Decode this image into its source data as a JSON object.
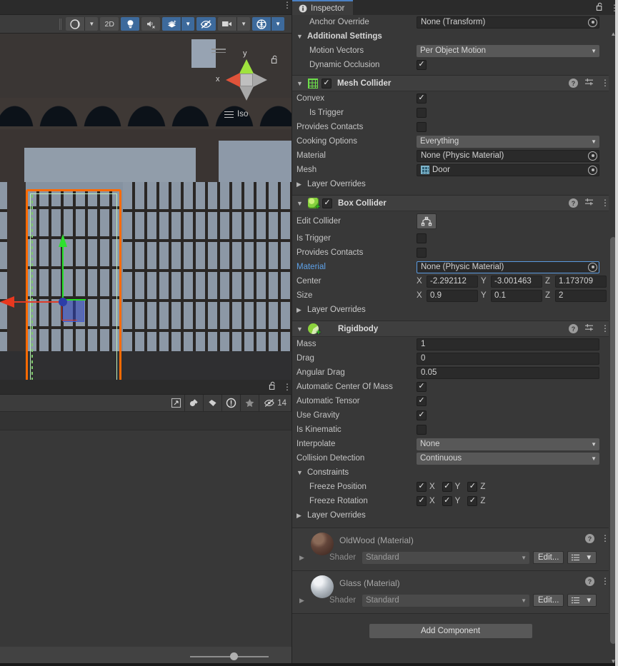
{
  "scene_panel": {
    "toolbar": {
      "shading_mode": "shaded-sphere-icon",
      "mode_2d": "2D",
      "lighting": "lightbulb-icon",
      "audio": "audio-mute-icon",
      "effects": "fx-layers-icon",
      "hidden_objects": "eye-off-icon",
      "camera": "camera-icon",
      "gizmos": "gizmos-globe-icon",
      "kebab": "⋮"
    },
    "orientation_gizmo": {
      "y_label": "y",
      "x_label": "x",
      "projection": "Iso",
      "lock": "unlocked-padlock-icon"
    }
  },
  "lower_panel": {
    "lock": "unlocked-padlock-icon",
    "kebab": "⋮",
    "buttons": [
      "expand-icon",
      "paint-icon",
      "tag-icon",
      "warning-icon",
      "star-icon"
    ],
    "hidden_count": "14",
    "zoom_slider_value": 52
  },
  "inspector": {
    "tab_label": "Inspector",
    "tab_icon": "info-icon",
    "lock_icon": "unlocked-padlock-icon",
    "kebab": "⋮",
    "top_fields": {
      "anchor_override_label": "Anchor Override",
      "anchor_override_value": "None (Transform)",
      "additional_settings_label": "Additional Settings",
      "motion_vectors_label": "Motion Vectors",
      "motion_vectors_value": "Per Object Motion",
      "dynamic_occlusion_label": "Dynamic Occlusion",
      "dynamic_occlusion_checked": true
    },
    "components": [
      {
        "id": "mesh-collider",
        "title": "Mesh Collider",
        "icon": "mesh-collider-icon",
        "enabled": true,
        "expanded": true,
        "rows": [
          {
            "label": "Convex",
            "type": "checkbox",
            "value": true,
            "indent": 0
          },
          {
            "label": "Is Trigger",
            "type": "checkbox",
            "value": false,
            "indent": 1
          },
          {
            "label": "Provides Contacts",
            "type": "checkbox",
            "value": false,
            "indent": 0
          },
          {
            "label": "Cooking Options",
            "type": "dropdown",
            "value": "Everything",
            "indent": 0
          },
          {
            "label": "Material",
            "type": "object",
            "value": "None (Physic Material)",
            "indent": 0
          },
          {
            "label": "Mesh",
            "type": "object-mesh",
            "value": "Door",
            "indent": 0
          }
        ],
        "layer_overrides_label": "Layer Overrides"
      },
      {
        "id": "box-collider",
        "title": "Box Collider",
        "icon": "box-collider-icon",
        "enabled": true,
        "expanded": true,
        "edit_collider_label": "Edit Collider",
        "edit_collider_icon": "collider-edit-icon",
        "rows": [
          {
            "label": "Is Trigger",
            "type": "checkbox",
            "value": false,
            "indent": 0
          },
          {
            "label": "Provides Contacts",
            "type": "checkbox",
            "value": false,
            "indent": 0
          },
          {
            "label": "Material",
            "type": "object",
            "value": "None (Physic Material)",
            "indent": 0,
            "highlighted": true
          }
        ],
        "center": {
          "label": "Center",
          "x": "-2.292112",
          "y": "-3.001463",
          "z": "1.173709"
        },
        "size": {
          "label": "Size",
          "x": "0.9",
          "y": "0.1",
          "z": "2"
        },
        "axis_labels": [
          "X",
          "Y",
          "Z"
        ],
        "layer_overrides_label": "Layer Overrides"
      },
      {
        "id": "rigidbody",
        "title": "Rigidbody",
        "icon": "rigidbody-icon",
        "expanded": true,
        "rows": [
          {
            "label": "Mass",
            "type": "text",
            "value": "1"
          },
          {
            "label": "Drag",
            "type": "text",
            "value": "0"
          },
          {
            "label": "Angular Drag",
            "type": "text",
            "value": "0.05"
          },
          {
            "label": "Automatic Center Of Mass",
            "type": "checkbox",
            "value": true
          },
          {
            "label": "Automatic Tensor",
            "type": "checkbox",
            "value": true
          },
          {
            "label": "Use Gravity",
            "type": "checkbox",
            "value": true
          },
          {
            "label": "Is Kinematic",
            "type": "checkbox",
            "value": false
          },
          {
            "label": "Interpolate",
            "type": "dropdown",
            "value": "None"
          },
          {
            "label": "Collision Detection",
            "type": "dropdown",
            "value": "Continuous"
          }
        ],
        "constraints_label": "Constraints",
        "freeze_position": {
          "label": "Freeze Position",
          "x": true,
          "y": true,
          "z": true
        },
        "freeze_rotation": {
          "label": "Freeze Rotation",
          "x": true,
          "y": true,
          "z": true
        },
        "axis_labels": [
          "X",
          "Y",
          "Z"
        ],
        "layer_overrides_label": "Layer Overrides"
      }
    ],
    "materials": [
      {
        "title": "OldWood (Material)",
        "shader_label": "Shader",
        "shader_value": "Standard",
        "edit_label": "Edit...",
        "thumb": "wood"
      },
      {
        "title": "Glass (Material)",
        "shader_label": "Shader",
        "shader_value": "Standard",
        "edit_label": "Edit...",
        "thumb": "glass"
      }
    ],
    "add_component_label": "Add Component"
  },
  "colors": {
    "accent_blue": "#4a80c4",
    "selection_orange": "#ff6a00",
    "selection_green": "#bff0bd",
    "toggle_active": "#3d6a9c",
    "axis_x": "#e8381f",
    "axis_y": "#2ee02e",
    "axis_z": "#2b3da8",
    "panel_bg": "#383838",
    "header_bg": "#3f3f3f",
    "field_bg": "#2a2a2a"
  }
}
